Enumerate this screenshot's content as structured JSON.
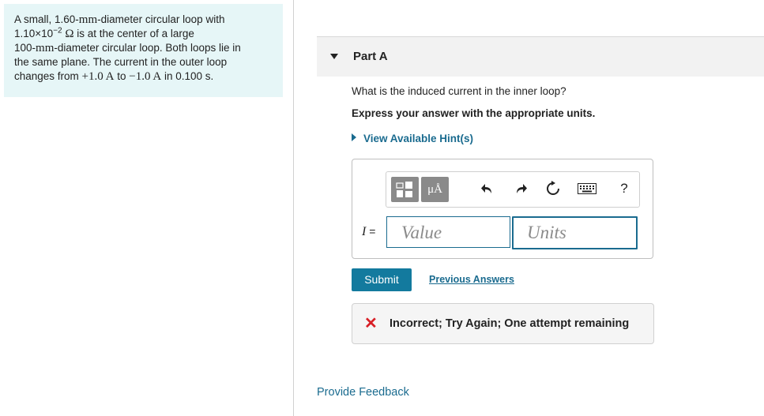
{
  "problem": {
    "line1_pre": "A small, 1.60-",
    "line1_mm": "mm",
    "line1_post": "-diameter circular loop with",
    "line2_coef": "1.10×10",
    "line2_exp": "−2",
    "line2_ohm": "Ω",
    "line2_post": " is at the center of a large",
    "line3_pre": "100-",
    "line3_mm": "mm",
    "line3_post": "-diameter circular loop. Both loops lie in",
    "line4": "the same plane. The current in the outer loop",
    "line5_pre": "changes from ",
    "line5_v1": "+1.0 A",
    "line5_to": " to ",
    "line5_v2": "−1.0 A",
    "line5_post": " in 0.100 s."
  },
  "part": {
    "title": "Part A"
  },
  "question": "What is the induced current in the inner loop?",
  "instruction": "Express your answer with the appropriate units.",
  "hint_link": "View Available Hint(s)",
  "toolbar": {
    "units_label": "μÅ",
    "help_label": "?",
    "icons": [
      "templates-icon",
      "units-icon",
      "undo-icon",
      "redo-icon",
      "reset-icon",
      "keyboard-icon",
      "help-icon"
    ]
  },
  "answer": {
    "variable": "I",
    "equals": " =",
    "value_placeholder": "Value",
    "units_placeholder": "Units"
  },
  "submit_label": "Submit",
  "previous_answers_label": "Previous Answers",
  "feedback": {
    "icon": "✕",
    "message": "Incorrect; Try Again; One attempt remaining"
  },
  "provide_feedback_label": "Provide Feedback",
  "colors": {
    "problem_bg": "#e6f6f7",
    "accent": "#1a6b8f",
    "submit_bg": "#137a9e",
    "error": "#d81f26"
  }
}
